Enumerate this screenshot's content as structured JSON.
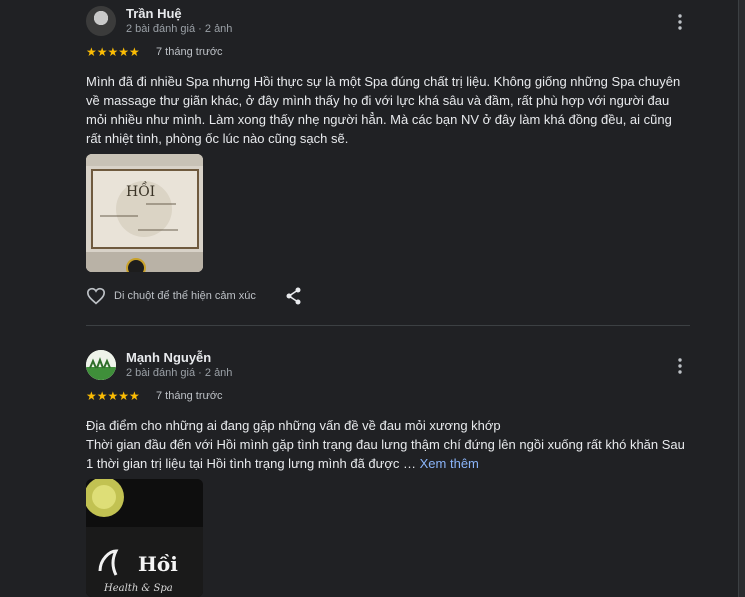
{
  "reviews": [
    {
      "author": "Trần Huệ",
      "meta": "2 bài đánh giá · 2 ảnh",
      "stars": "★★★★★",
      "rating": 5,
      "time": "7 tháng trước",
      "text": "Mình đã đi nhiều Spa nhưng Hồi thực sự là một Spa đúng chất trị liệu. Không giống những Spa chuyên về massage thư giãn khác, ở đây mình thấy họ đi với lực khá sâu và đầm, rất phù hợp với người đau mỏi nhiều như mình. Làm xong thấy nhẹ người hẳn. Mà các bạn NV ở đây làm khá đồng đều, ai cũng rất nhiệt tình, phòng ốc lúc nào cũng sạch sẽ.",
      "photo_sign": "HỒI",
      "reaction_label": "Di chuột để thể hiện cảm xúc"
    },
    {
      "author": "Mạnh Nguyễn",
      "meta": "2 bài đánh giá · 2 ảnh",
      "stars": "★★★★★",
      "rating": 5,
      "time": "7 tháng trước",
      "text_line1": "Địa điểm cho những ai đang gặp những vấn đề về đau mỏi xương khớp",
      "text_line2": "Thời gian đầu đến với Hồi mình gặp tình trạng đau lưng thậm chí đứng lên ngồi xuống rất khó khăn Sau 1 thời gian trị liệu tại Hồi tình trạng lưng mình đã được …",
      "more_label": "Xem thêm",
      "photo_sign": "Hồi",
      "photo_sub": "Health & Spa"
    }
  ],
  "colors": {
    "background": "#202124",
    "star": "#fbbc04",
    "link": "#8ab4f8"
  },
  "icons": [
    "more-vert-icon",
    "heart-icon",
    "share-icon",
    "avatar"
  ]
}
